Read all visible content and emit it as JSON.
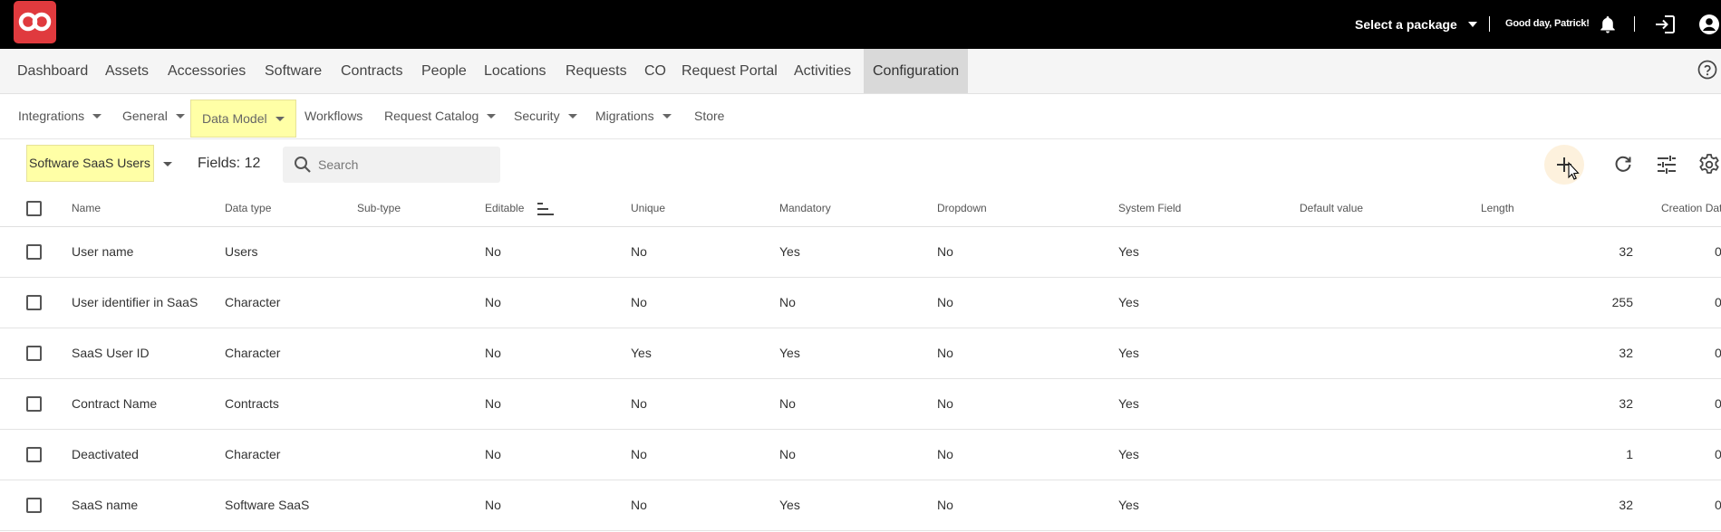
{
  "topbar": {
    "logo_icon": "infinity-logo-icon",
    "package_label": "Select a package",
    "greeting": "Good day, Patrick!",
    "icons": [
      "bell-icon",
      "logout-icon",
      "account-icon"
    ]
  },
  "main_nav": {
    "items": [
      {
        "label": "Dashboard"
      },
      {
        "label": "Assets"
      },
      {
        "label": "Accessories"
      },
      {
        "label": "Software"
      },
      {
        "label": "Contracts"
      },
      {
        "label": "People"
      },
      {
        "label": "Locations"
      },
      {
        "label": "Requests"
      },
      {
        "label": "CO"
      },
      {
        "label": "Request Portal"
      },
      {
        "label": "Activities"
      },
      {
        "label": "Configuration",
        "active": true
      }
    ],
    "help_icon": "help-circle-icon"
  },
  "sub_nav": {
    "items": [
      {
        "label": "Integrations",
        "dropdown": true
      },
      {
        "label": "General",
        "dropdown": true
      },
      {
        "label": "Data Model",
        "dropdown": true,
        "active": true
      },
      {
        "label": "Workflows",
        "dropdown": false
      },
      {
        "label": "Request Catalog",
        "dropdown": true
      },
      {
        "label": "Security",
        "dropdown": true
      },
      {
        "label": "Migrations",
        "dropdown": true
      },
      {
        "label": "Store",
        "dropdown": false
      }
    ]
  },
  "toolbar": {
    "entity": "Software SaaS Users",
    "fields_label": "Fields: 12",
    "search_placeholder": "Search",
    "buttons": [
      "add-icon",
      "refresh-icon",
      "filter-sliders-icon",
      "settings-gear-icon"
    ]
  },
  "table": {
    "headers": {
      "name": "Name",
      "data_type": "Data type",
      "sub_type": "Sub-type",
      "editable": "Editable",
      "unique": "Unique",
      "mandatory": "Mandatory",
      "dropdown": "Dropdown",
      "system_field": "System Field",
      "default_value": "Default value",
      "length": "Length",
      "creation_date": "Creation Dat"
    },
    "rows": [
      {
        "name": "User name",
        "data_type": "Users",
        "sub_type": "",
        "editable": "No",
        "unique": "No",
        "mandatory": "Yes",
        "dropdown": "No",
        "system_field": "Yes",
        "default_value": "",
        "length": "32",
        "creation_date": "0"
      },
      {
        "name": "User identifier in SaaS",
        "data_type": "Character",
        "sub_type": "",
        "editable": "No",
        "unique": "No",
        "mandatory": "No",
        "dropdown": "No",
        "system_field": "Yes",
        "default_value": "",
        "length": "255",
        "creation_date": "0"
      },
      {
        "name": "SaaS User ID",
        "data_type": "Character",
        "sub_type": "",
        "editable": "No",
        "unique": "Yes",
        "mandatory": "Yes",
        "dropdown": "No",
        "system_field": "Yes",
        "default_value": "",
        "length": "32",
        "creation_date": "0"
      },
      {
        "name": "Contract Name",
        "data_type": "Contracts",
        "sub_type": "",
        "editable": "No",
        "unique": "No",
        "mandatory": "No",
        "dropdown": "No",
        "system_field": "Yes",
        "default_value": "",
        "length": "32",
        "creation_date": "0"
      },
      {
        "name": "Deactivated",
        "data_type": "Character",
        "sub_type": "",
        "editable": "No",
        "unique": "No",
        "mandatory": "No",
        "dropdown": "No",
        "system_field": "Yes",
        "default_value": "",
        "length": "1",
        "creation_date": "0"
      },
      {
        "name": "SaaS name",
        "data_type": "Software SaaS",
        "sub_type": "",
        "editable": "No",
        "unique": "No",
        "mandatory": "Yes",
        "dropdown": "No",
        "system_field": "Yes",
        "default_value": "",
        "length": "32",
        "creation_date": "0"
      }
    ]
  }
}
